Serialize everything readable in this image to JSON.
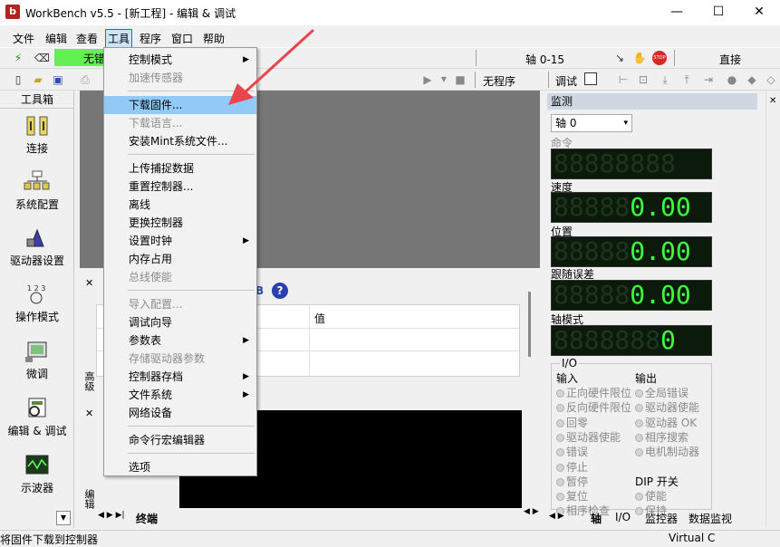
{
  "window": {
    "title": "WorkBench v5.5 - [新工程] - 编辑 & 调试",
    "min": "—",
    "max": "☐",
    "close": "✕"
  },
  "menubar": [
    "文件",
    "编辑",
    "查看",
    "工具",
    "程序",
    "窗口",
    "帮助"
  ],
  "toolbar1": {
    "status": "无错",
    "axis_label": "轴 0-15",
    "mode": "直接"
  },
  "toolbar2": {
    "program": "无程序",
    "debug": "调试"
  },
  "toolbox": {
    "title": "工具箱",
    "items": [
      "连接",
      "系统配置",
      "驱动器设置",
      "操作模式",
      "微调",
      "编辑 & 调试",
      "示波器"
    ]
  },
  "tools_menu": {
    "items": [
      {
        "label": "控制模式",
        "disabled": false,
        "submenu": true
      },
      {
        "label": "加速传感器",
        "disabled": true,
        "submenu": false
      },
      {
        "label": "下载固件...",
        "disabled": false,
        "submenu": false,
        "selected": true
      },
      {
        "label": "下载语言...",
        "disabled": true,
        "submenu": false
      },
      {
        "label": "安装Mint系统文件...",
        "disabled": false,
        "submenu": false
      },
      {
        "label": "上传捕捉数据",
        "disabled": false,
        "submenu": false
      },
      {
        "label": "重置控制器...",
        "disabled": false,
        "submenu": false
      },
      {
        "label": "离线",
        "disabled": false,
        "submenu": false
      },
      {
        "label": "更换控制器",
        "disabled": false,
        "submenu": false
      },
      {
        "label": "设置时钟",
        "disabled": false,
        "submenu": true
      },
      {
        "label": "内存占用",
        "disabled": false,
        "submenu": false
      },
      {
        "label": "总线使能",
        "disabled": true,
        "submenu": false
      },
      {
        "label": "导入配置...",
        "disabled": true,
        "submenu": false
      },
      {
        "label": "调试向导",
        "disabled": false,
        "submenu": false
      },
      {
        "label": "参数表",
        "disabled": false,
        "submenu": true
      },
      {
        "label": "存储驱动器参数",
        "disabled": true,
        "submenu": false
      },
      {
        "label": "控制器存档",
        "disabled": false,
        "submenu": true
      },
      {
        "label": "文件系统",
        "disabled": false,
        "submenu": true
      },
      {
        "label": "网络设备",
        "disabled": false,
        "submenu": false
      },
      {
        "label": "命令行宏编辑器",
        "disabled": false,
        "submenu": false
      },
      {
        "label": "选项",
        "disabled": false,
        "submenu": false
      }
    ]
  },
  "lower_panel": {
    "value_header": "值",
    "left_tab": "高级",
    "terminal_tab": "终端",
    "left_tab2": "编辑"
  },
  "monitor": {
    "title": "监测",
    "axis": "轴 0",
    "labels": {
      "command": "命令",
      "speed": "速度",
      "position": "位置",
      "following_error": "跟随误差",
      "axis_mode": "轴模式"
    },
    "values": {
      "speed": "0.00",
      "position": "0.00",
      "following_error": "0.00",
      "axis_mode": "0"
    },
    "io_title": "I/O",
    "inputs_title": "输入",
    "outputs_title": "输出",
    "inputs": [
      "正向硬件限位",
      "反向硬件限位",
      "回零",
      "驱动器使能",
      "错误",
      "停止",
      "暂停",
      "复位",
      "相序检查"
    ],
    "outputs": [
      "全局错误",
      "驱动器使能",
      "驱动器 OK",
      "相序搜索",
      "电机制动器"
    ],
    "dip_title": "DIP 开关",
    "dip": [
      "使能",
      "保持"
    ],
    "tabs": [
      "轴",
      "I/O",
      "监控器",
      "数据监视"
    ]
  },
  "status_bar": {
    "message": "将固件下载到控制器",
    "right": "Virtual C"
  },
  "colors": {
    "selected": "#91c9f7",
    "status_green": "#66ee55",
    "arrow": "#e8454d"
  }
}
